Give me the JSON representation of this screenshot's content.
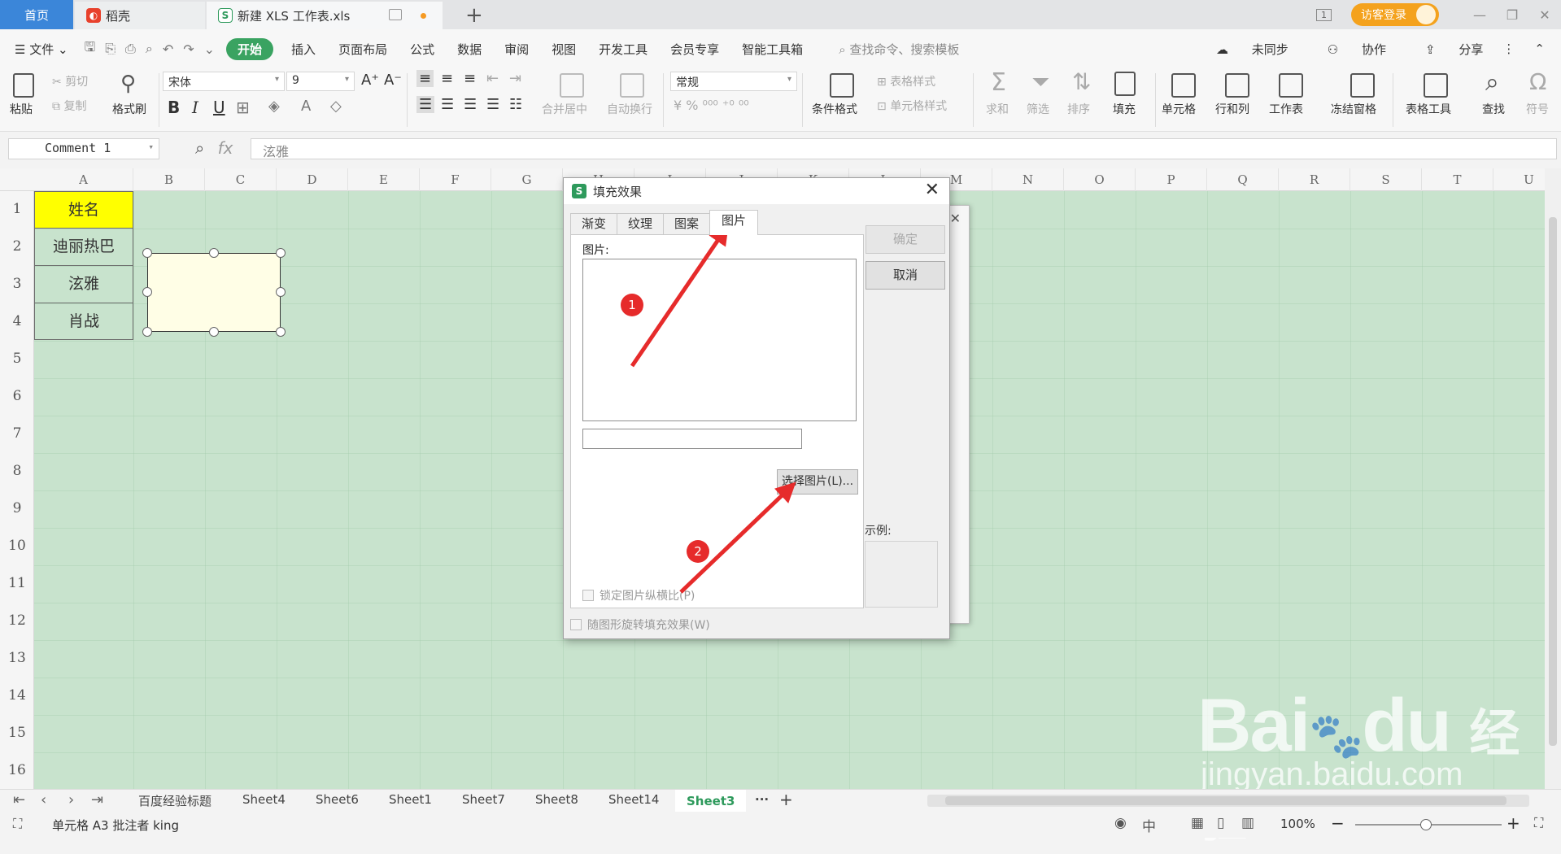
{
  "titlebar": {
    "home_tab": "首页",
    "docer_tab": "稻壳",
    "doc_tab": "新建 XLS 工作表.xls",
    "new_tab": "+",
    "login_button": "访客登录",
    "page_count_badge": "1"
  },
  "menubar": {
    "file": "文件",
    "items": [
      "开始",
      "插入",
      "页面布局",
      "公式",
      "数据",
      "审阅",
      "视图",
      "开发工具",
      "会员专享",
      "智能工具箱"
    ],
    "search_placeholder": "查找命令、搜索模板",
    "sync": "未同步",
    "collab": "协作",
    "share": "分享"
  },
  "ribbon": {
    "paste": "粘贴",
    "cut": "剪切",
    "copy": "复制",
    "format_painter": "格式刷",
    "font_name": "宋体",
    "font_size": "9",
    "merge_center": "合并居中",
    "wrap_text": "自动换行",
    "number_format": "常规",
    "cond_format": "条件格式",
    "table_style": "表格样式",
    "cell_style": "单元格样式",
    "sum": "求和",
    "filter": "筛选",
    "sort": "排序",
    "fill": "填充",
    "cell": "单元格",
    "row_col": "行和列",
    "worksheet": "工作表",
    "freeze": "冻结窗格",
    "table_tools": "表格工具",
    "find": "查找",
    "symbol": "符号"
  },
  "formula_bar": {
    "name_box": "Comment 1",
    "fx": "fx",
    "content": "泫雅"
  },
  "grid": {
    "columns": [
      "A",
      "B",
      "C",
      "D",
      "E",
      "F",
      "G",
      "H",
      "I",
      "J",
      "K",
      "L",
      "M",
      "N",
      "O",
      "P",
      "Q",
      "R",
      "S",
      "T",
      "U"
    ],
    "rows": [
      "1",
      "2",
      "3",
      "4",
      "5",
      "6",
      "7",
      "8",
      "9",
      "10",
      "11",
      "12",
      "13",
      "14",
      "15",
      "16"
    ],
    "cells": [
      "姓名",
      "迪丽热巴",
      "泫雅",
      "肖战"
    ],
    "header_fill": "#ffff00",
    "sheet_bg": "#c8e3cd"
  },
  "dialog": {
    "title": "填充效果",
    "tabs": [
      "渐变",
      "纹理",
      "图案",
      "图片"
    ],
    "active_tab": "图片",
    "picture_label": "图片:",
    "choose_picture": "选择图片(L)...",
    "lock_ratio": "锁定图片纵横比(P)",
    "rotate_with_shape": "随图形旋转填充效果(W)",
    "ok": "确定",
    "cancel": "取消",
    "sample_label": "示例:"
  },
  "annotations": {
    "badge_1": "1",
    "badge_2": "2",
    "arrow_color": "#e62b2b"
  },
  "sheet_tabs": {
    "tabs": [
      "百度经验标题",
      "Sheet4",
      "Sheet6",
      "Sheet1",
      "Sheet7",
      "Sheet8",
      "Sheet14",
      "Sheet3"
    ],
    "active": "Sheet3",
    "more": "···",
    "add": "+"
  },
  "statusbar": {
    "text": "单元格 A3 批注者 king",
    "zoom": "100%"
  },
  "watermark": {
    "brand": "Bai",
    "brand2": "du",
    "cn": "经验",
    "url": "jingyan.baidu.com"
  }
}
